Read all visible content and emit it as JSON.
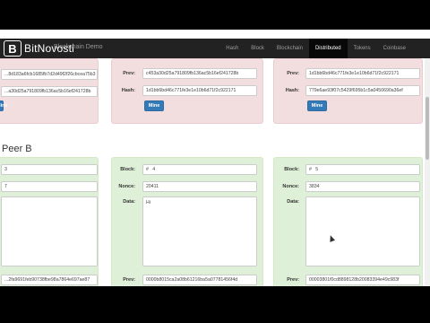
{
  "brand": {
    "mark": "B",
    "name": "BitNovosti",
    "subtitle": "Blockchain Demo"
  },
  "nav": {
    "items": [
      "Hash",
      "Block",
      "Blockchain",
      "Distributed",
      "Tokens",
      "Coinbase"
    ],
    "active": "Distributed"
  },
  "peer_a": {
    "cards": [
      {
        "hash_fragment": "...8d183a6fcb1685fb7d2d49f2f26cbcea75b3",
        "prev_hash_fragment": "...a30d25a791809fb136ac5b16ef241728b"
      },
      {
        "prev": "c453a30d25a791809fb136ac5b16ef241728b",
        "hash": "1d1bb6bd46c771fe3e1e10b6d71f2c922171"
      },
      {
        "prev": "1d1bb6bd46c771fe3e1e10b6d71f2c922171",
        "hash": "779e6ae93f07c5429f695b1c5a0450690a36ef"
      }
    ]
  },
  "peer_b": {
    "title": "Peer B",
    "cards": [
      {
        "block": "3",
        "nonce": "7",
        "data": "",
        "prev": "...2fa9691feb90738fbe98a7864e697ae87"
      },
      {
        "block": "4",
        "nonce": "20411",
        "data": "Hi",
        "prev": "0000b8015ca2a08b61216ba5a07781456f4d"
      },
      {
        "block": "5",
        "nonce": "3834",
        "data": "",
        "prev": "00003801f0cd8898128b20083394e49c983f"
      }
    ]
  },
  "labels": {
    "block": "Block:",
    "nonce": "Nonce:",
    "data": "Data:",
    "prev": "Prev:",
    "hash": "Hash:",
    "mine": "Mine",
    "hash_sign": "#"
  },
  "colors": {
    "mined_ok": "#dff0d8",
    "invalid": "#f2dede",
    "primary_button": "#337ab7"
  }
}
